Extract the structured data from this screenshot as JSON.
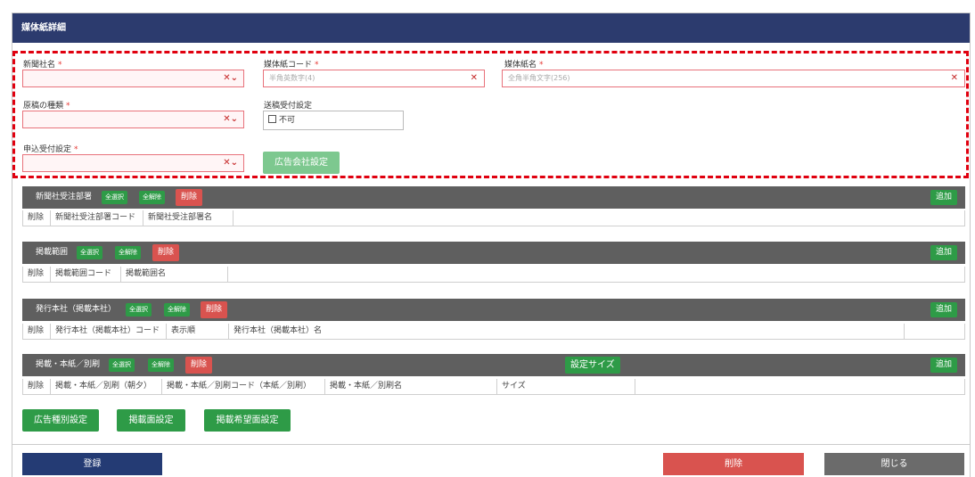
{
  "header": {
    "title": "媒体紙詳細"
  },
  "form": {
    "newspaper_name": {
      "label": "新聞社名",
      "req": "*",
      "value": ""
    },
    "media_code": {
      "label": "媒体紙コード",
      "req": "*",
      "placeholder": "半角英数字(4)"
    },
    "media_name": {
      "label": "媒体紙名",
      "req": "*",
      "placeholder": "全角半角文字(256)"
    },
    "manuscript_type": {
      "label": "原稿の種類",
      "req": "*",
      "value": ""
    },
    "send_setting": {
      "label": "送稿受付設定",
      "checkbox_label": "不可",
      "checked": false
    },
    "apply_setting": {
      "label": "申込受付設定",
      "req": "*",
      "value": ""
    },
    "ad_company_button": "広告会社設定",
    "clear_glyph": "✕",
    "dropdown_glyph": "✕⌄"
  },
  "sections": [
    {
      "title": "新聞社受注部署",
      "select_all": "全選択",
      "deselect_all": "全解除",
      "delete": "削除",
      "add": "追加",
      "columns": [
        "削除",
        "新聞社受注部署コード",
        "新聞社受注部署名"
      ]
    },
    {
      "title": "掲載範囲",
      "select_all": "全選択",
      "deselect_all": "全解除",
      "delete": "削除",
      "add": "追加",
      "columns": [
        "削除",
        "掲載範囲コード",
        "掲載範囲名"
      ]
    },
    {
      "title": "発行本社（掲載本社）",
      "select_all": "全選択",
      "deselect_all": "全解除",
      "delete": "削除",
      "add": "追加",
      "columns": [
        "削除",
        "発行本社（掲載本社）コード",
        "表示順",
        "発行本社（掲載本社）名"
      ]
    },
    {
      "title": "掲載・本紙／別刷",
      "select_all": "全選択",
      "deselect_all": "全解除",
      "delete": "削除",
      "add": "追加",
      "size_setting": "設定サイズ",
      "columns": [
        "削除",
        "掲載・本紙／別刷（朝夕）",
        "掲載・本紙／別刷コード（本紙／別刷）",
        "掲載・本紙／別刷名",
        "サイズ"
      ]
    }
  ],
  "bottom_buttons": {
    "ad_type": "広告種別設定",
    "page": "掲載面設定",
    "wish_page": "掲載希望面設定"
  },
  "footer": {
    "register": "登録",
    "delete": "削除",
    "close": "閉じる"
  },
  "colors": {
    "header": "#2c3b6e",
    "green": "#2e9b47",
    "red": "#d9534f",
    "dash": "#e0000f"
  }
}
